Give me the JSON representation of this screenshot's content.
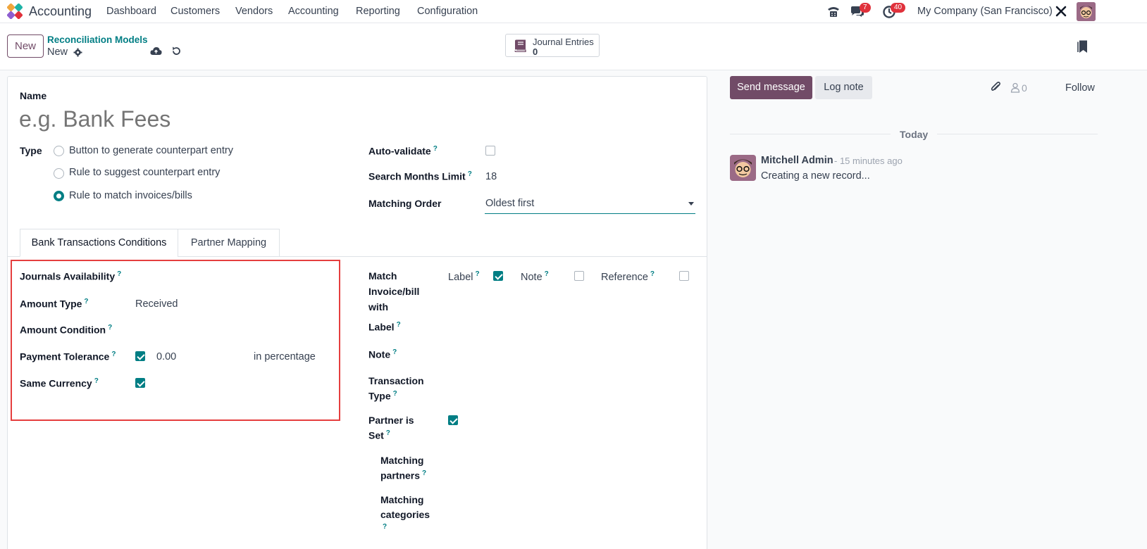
{
  "navbar": {
    "app_icon": "odoo-accounting-icon",
    "app_name": "Accounting",
    "menu": [
      "Dashboard",
      "Customers",
      "Vendors",
      "Accounting",
      "Reporting",
      "Configuration"
    ],
    "messages_badge": "7",
    "activities_badge": "40",
    "company": "My Company (San Francisco)"
  },
  "control_panel": {
    "new_label": "New",
    "breadcrumb_parent": "Reconciliation Models",
    "breadcrumb_current": "New",
    "smart_button_label": "Journal Entries",
    "smart_button_value": "0"
  },
  "form": {
    "name_label": "Name",
    "name_placeholder": "e.g. Bank Fees",
    "type_label": "Type",
    "type_options": [
      "Button to generate counterpart entry",
      "Rule to suggest counterpart entry",
      "Rule to match invoices/bills"
    ],
    "type_selected": "Rule to match invoices/bills",
    "auto_validate_label": "Auto-validate",
    "auto_validate": false,
    "search_months_label": "Search Months Limit",
    "search_months_value": "18",
    "matching_order_label": "Matching Order",
    "matching_order_value": "Oldest first",
    "tabs": [
      "Bank Transactions Conditions",
      "Partner Mapping"
    ],
    "active_tab": "Bank Transactions Conditions",
    "left": {
      "journals_label": "Journals Availability",
      "amount_type_label": "Amount Type",
      "amount_type_value": "Received",
      "amount_condition_label": "Amount Condition",
      "payment_tolerance_label": "Payment Tolerance",
      "payment_tolerance_checked": true,
      "payment_tolerance_value": "0.00",
      "payment_tolerance_unit": "in percentage",
      "same_currency_label": "Same Currency",
      "same_currency_checked": true
    },
    "right": {
      "match_with_label_1": "Match",
      "match_with_label_2": "Invoice/bill",
      "match_with_label_3": "with",
      "match_label": "Label",
      "match_label_checked": true,
      "match_note": "Note",
      "match_note_checked": false,
      "match_reference": "Reference",
      "match_reference_checked": false,
      "label_label": "Label",
      "note_label": "Note",
      "transaction_type_1": "Transaction",
      "transaction_type_2": "Type",
      "partner_set_1": "Partner is",
      "partner_set_2": "Set",
      "partner_set_checked": true,
      "matching_partners_1": "Matching",
      "matching_partners_2": "partners",
      "matching_categories_1": "Matching",
      "matching_categories_2": "categories"
    },
    "highlight_color": "#e53e3e"
  },
  "chatter": {
    "send_message": "Send message",
    "log_note": "Log note",
    "followers_count": "0",
    "follow": "Follow",
    "date_separator": "Today",
    "author": "Mitchell Admin",
    "time": "- 15 minutes ago",
    "body": "Creating a new record..."
  },
  "colors": {
    "brand": "#714b67",
    "accent": "#017e84"
  }
}
